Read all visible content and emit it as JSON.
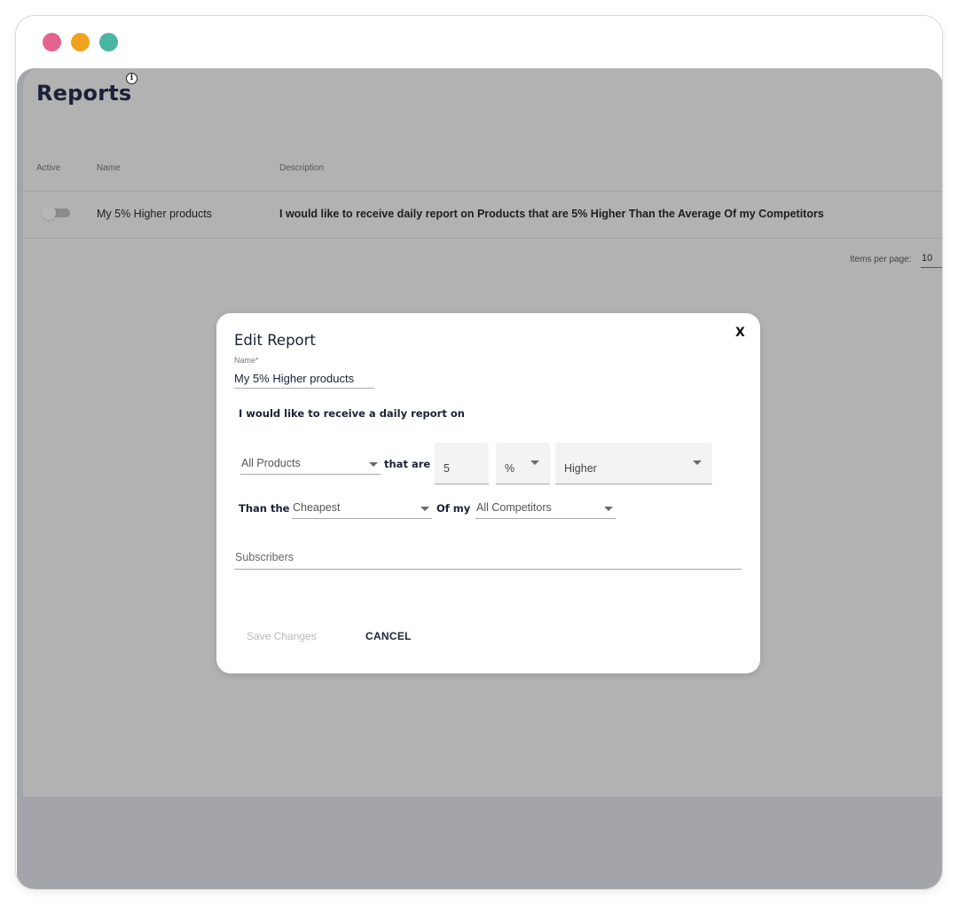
{
  "window": {
    "traffic_lights": [
      {
        "name": "close",
        "color": "#e4638f"
      },
      {
        "name": "minimize",
        "color": "#f1a21f"
      },
      {
        "name": "maximize",
        "color": "#4cb5a2"
      }
    ]
  },
  "page": {
    "title": "Reports",
    "info_icon": "i",
    "table": {
      "headers": [
        "Active",
        "Name",
        "Description"
      ],
      "rows": [
        {
          "active": false,
          "name": "My 5% Higher products",
          "description": "I would like to receive daily report on Products that are 5% Higher Than the Average Of my Competitors"
        }
      ]
    },
    "pagination": {
      "items_per_page_label": "Items per page:",
      "items_per_page_value": "10"
    }
  },
  "modal": {
    "title": "Edit Report",
    "close_label": "X",
    "name_label": "Name*",
    "name_value": "My 5% Higher products",
    "sentence": "I would like to receive a daily report on",
    "products_select": "All Products",
    "that_are_label": "that are",
    "amount_value": "5",
    "unit_select": "%",
    "direction_select": "Higher",
    "than_the_label": "Than the",
    "comparison_select": "Cheapest",
    "of_my_label": "Of my",
    "competitors_select": "All Competitors",
    "subscribers_placeholder": "Subscribers",
    "save_label": "Save Changes",
    "cancel_label": "CANCEL"
  }
}
